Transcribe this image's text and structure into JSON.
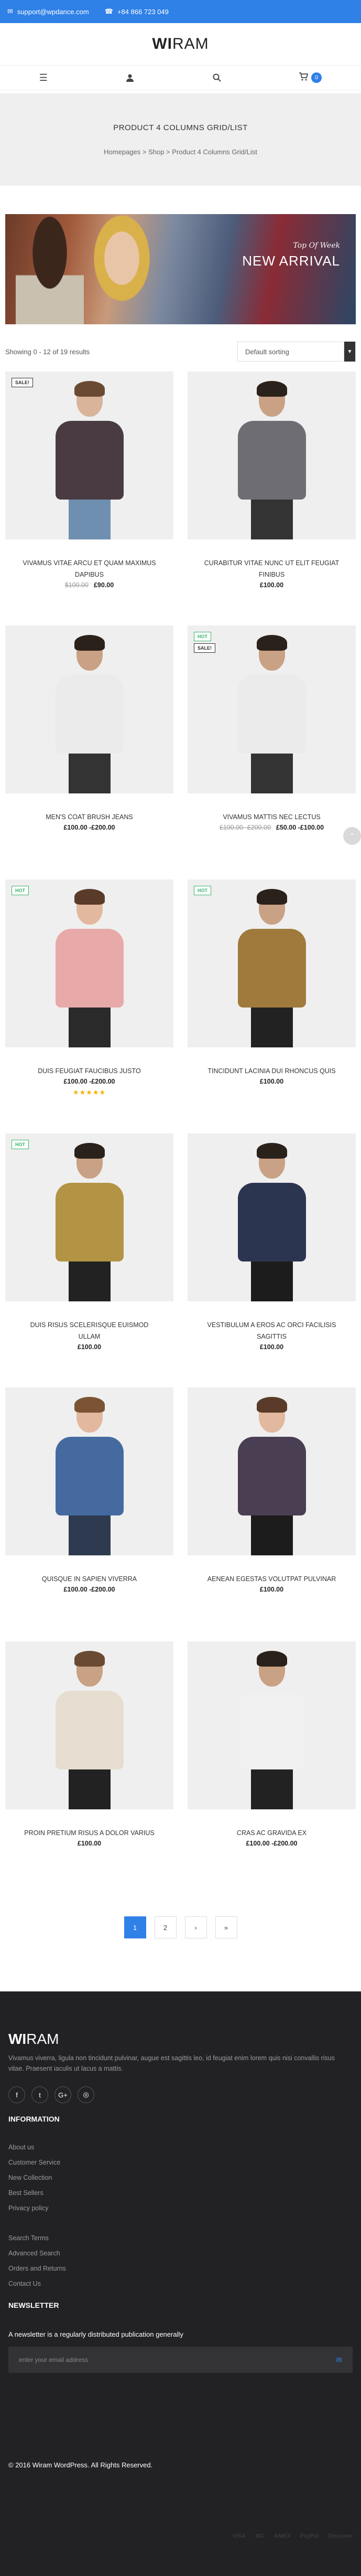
{
  "topbar": {
    "email": "support@wpdance.com",
    "phone": "+84 866 723 049"
  },
  "logo": {
    "bold": "WI",
    "light": "RAM"
  },
  "header": {
    "cart_count": "0"
  },
  "page": {
    "title": "PRODUCT 4 COLUMNS GRID/LIST",
    "breadcrumb": "Homepages > Shop > Product 4 Columns Grid/List"
  },
  "banner": {
    "subtitle": "Top Of Week",
    "title": "NEW ARRIVAL"
  },
  "toolbar": {
    "result_count": "Showing 0 - 12 of 19 results",
    "sort_selected": "Default sorting"
  },
  "products": [
    {
      "name": "VIVAMUS VITAE ARCU ET QUAM MAXIMUS DAPIBUS",
      "old_price": "$100.00",
      "price": "£90.00",
      "badges": [
        "SALE!"
      ],
      "torso": "#4a3b43",
      "legs": "#6f8fb0",
      "skin": "#d9b39a",
      "hair": "#6b4a34"
    },
    {
      "name": "CURABITUR VITAE NUNC UT ELIT FEUGIAT FINIBUS",
      "old_price": "",
      "price": "£100.00",
      "badges": [],
      "torso": "#6d6d73",
      "legs": "#333",
      "skin": "#c9a184",
      "hair": "#2b211b"
    },
    {
      "name": "MEN'S COAT BRUSH JEANS",
      "old_price": "",
      "price": "£100.00 -£200.00",
      "badges": [],
      "torso": "#ebebeb",
      "legs": "#333",
      "skin": "#c9a184",
      "hair": "#2b211b"
    },
    {
      "name": "VIVAMUS MATTIS NEC LECTUS",
      "old_price": "£100.00 -£200.00",
      "price": "£50.00 -£100.00",
      "badges": [
        "HOT",
        "SALE!"
      ],
      "torso": "#ebebeb",
      "legs": "#333",
      "skin": "#c9a184",
      "hair": "#2b211b"
    },
    {
      "name": "DUIS FEUGIAT FAUCIBUS JUSTO",
      "old_price": "",
      "price": "£100.00 -£200.00",
      "badges": [
        "HOT"
      ],
      "rating": "★★★★★",
      "torso": "#e8a9a9",
      "legs": "#2a2a2a",
      "skin": "#e2b89e",
      "hair": "#5a3b2a"
    },
    {
      "name": "TINCIDUNT LACINIA DUI RHONCUS QUIS",
      "old_price": "",
      "price": "£100.00",
      "badges": [
        "HOT"
      ],
      "torso": "#a07a3c",
      "legs": "#222",
      "skin": "#c9a184",
      "hair": "#2b211b"
    },
    {
      "name": "DUIS RISUS SCELERISQUE EUISMOD ULLAM",
      "old_price": "",
      "price": "£100.00",
      "badges": [
        "HOT"
      ],
      "torso": "#b39444",
      "legs": "#222",
      "skin": "#c9a184",
      "hair": "#2b211b"
    },
    {
      "name": "VESTIBULUM A EROS AC ORCI FACILISIS SAGITTIS",
      "old_price": "",
      "price": "£100.00",
      "badges": [],
      "torso": "#2c3550",
      "legs": "#1c1c1c",
      "skin": "#c9a184",
      "hair": "#2b211b"
    },
    {
      "name": "QUISQUE IN SAPIEN VIVERRA",
      "old_price": "",
      "price": "£100.00 -£200.00",
      "badges": [],
      "torso": "#456aa0",
      "legs": "#2e3a4f",
      "skin": "#e2b89e",
      "hair": "#7a5434"
    },
    {
      "name": "AENEAN EGESTAS VOLUTPAT PULVINAR",
      "old_price": "",
      "price": "£100.00",
      "badges": [],
      "torso": "#4a3e52",
      "legs": "#1c1c1c",
      "skin": "#e2b89e",
      "hair": "#5a3b2a"
    },
    {
      "name": "PROIN PRETIUM RISUS A DOLOR VARIUS",
      "old_price": "",
      "price": "£100.00",
      "badges": [],
      "torso": "#e6ddd0",
      "legs": "#222",
      "skin": "#c9a184",
      "hair": "#6b4a34"
    },
    {
      "name": "CRAS AC GRAVIDA EX",
      "old_price": "",
      "price": "£100.00 -£200.00",
      "badges": [],
      "torso": "#f0f0f0",
      "legs": "#222",
      "skin": "#c9a184",
      "hair": "#2b211b"
    }
  ],
  "pagination": [
    "1",
    "2",
    "›",
    "»"
  ],
  "footer": {
    "logo_bold": "WI",
    "logo_light": "RAM",
    "about": "Vivamus viverra, ligula non tincidunt pulvinar, augue est sagittis leo, id feugiat enim lorem quis nisi convallis risus vitae. Praesent iaculis ut lacus a mattis.",
    "social": [
      "f",
      "t",
      "G+",
      "◎"
    ],
    "info_heading": "INFORMATION",
    "links_1": [
      "About us",
      "Customer Service",
      "New Collection",
      "Best Sellers",
      "Privacy policy"
    ],
    "links_2": [
      "Search Terms",
      "Advanced Search",
      "Orders and Returns",
      "Contact Us"
    ],
    "newsletter_heading": "NEWSLETTER",
    "newsletter_desc": "A newsletter is a regularly distributed publication generally",
    "newsletter_placeholder": "enter your email address",
    "copyright": "© 2016 Wiram WordPress. All Rights Reserved.",
    "payments": [
      "VISA",
      "MC",
      "AMEX",
      "PayPal",
      "Discover"
    ]
  },
  "colors": {
    "accent": "#2f80e7",
    "footer_bg": "#222224",
    "hot_badge": "#34b56a",
    "rating": "#f5b200"
  }
}
